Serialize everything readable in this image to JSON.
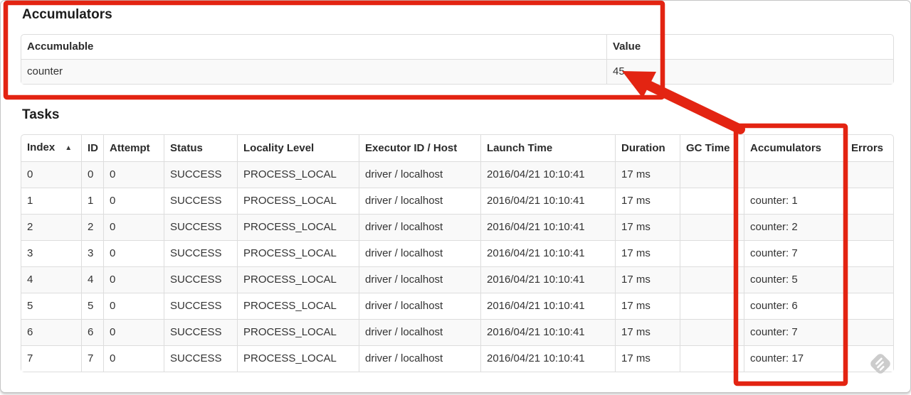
{
  "theme": {
    "annotation_color": "#e32412",
    "table_border_color": "#dddddd",
    "stripe_color": "#f9f9f9",
    "watermark_color": "#cccccc"
  },
  "accumulators_section": {
    "title": "Accumulators",
    "table": {
      "headers": [
        "Accumulable",
        "Value"
      ],
      "rows": [
        [
          "counter",
          "45"
        ]
      ]
    }
  },
  "tasks_section": {
    "title": "Tasks",
    "sort_indicator": "▲",
    "table": {
      "headers": [
        "Index",
        "ID",
        "Attempt",
        "Status",
        "Locality Level",
        "Executor ID / Host",
        "Launch Time",
        "Duration",
        "GC Time",
        "Accumulators",
        "Errors"
      ],
      "rows": [
        [
          "0",
          "0",
          "0",
          "SUCCESS",
          "PROCESS_LOCAL",
          "driver / localhost",
          "2016/04/21 10:10:41",
          "17 ms",
          "",
          "",
          ""
        ],
        [
          "1",
          "1",
          "0",
          "SUCCESS",
          "PROCESS_LOCAL",
          "driver / localhost",
          "2016/04/21 10:10:41",
          "17 ms",
          "",
          "counter: 1",
          ""
        ],
        [
          "2",
          "2",
          "0",
          "SUCCESS",
          "PROCESS_LOCAL",
          "driver / localhost",
          "2016/04/21 10:10:41",
          "17 ms",
          "",
          "counter: 2",
          ""
        ],
        [
          "3",
          "3",
          "0",
          "SUCCESS",
          "PROCESS_LOCAL",
          "driver / localhost",
          "2016/04/21 10:10:41",
          "17 ms",
          "",
          "counter: 7",
          ""
        ],
        [
          "4",
          "4",
          "0",
          "SUCCESS",
          "PROCESS_LOCAL",
          "driver / localhost",
          "2016/04/21 10:10:41",
          "17 ms",
          "",
          "counter: 5",
          ""
        ],
        [
          "5",
          "5",
          "0",
          "SUCCESS",
          "PROCESS_LOCAL",
          "driver / localhost",
          "2016/04/21 10:10:41",
          "17 ms",
          "",
          "counter: 6",
          ""
        ],
        [
          "6",
          "6",
          "0",
          "SUCCESS",
          "PROCESS_LOCAL",
          "driver / localhost",
          "2016/04/21 10:10:41",
          "17 ms",
          "",
          "counter: 7",
          ""
        ],
        [
          "7",
          "7",
          "0",
          "SUCCESS",
          "PROCESS_LOCAL",
          "driver / localhost",
          "2016/04/21 10:10:41",
          "17 ms",
          "",
          "counter: 17",
          ""
        ]
      ]
    }
  }
}
